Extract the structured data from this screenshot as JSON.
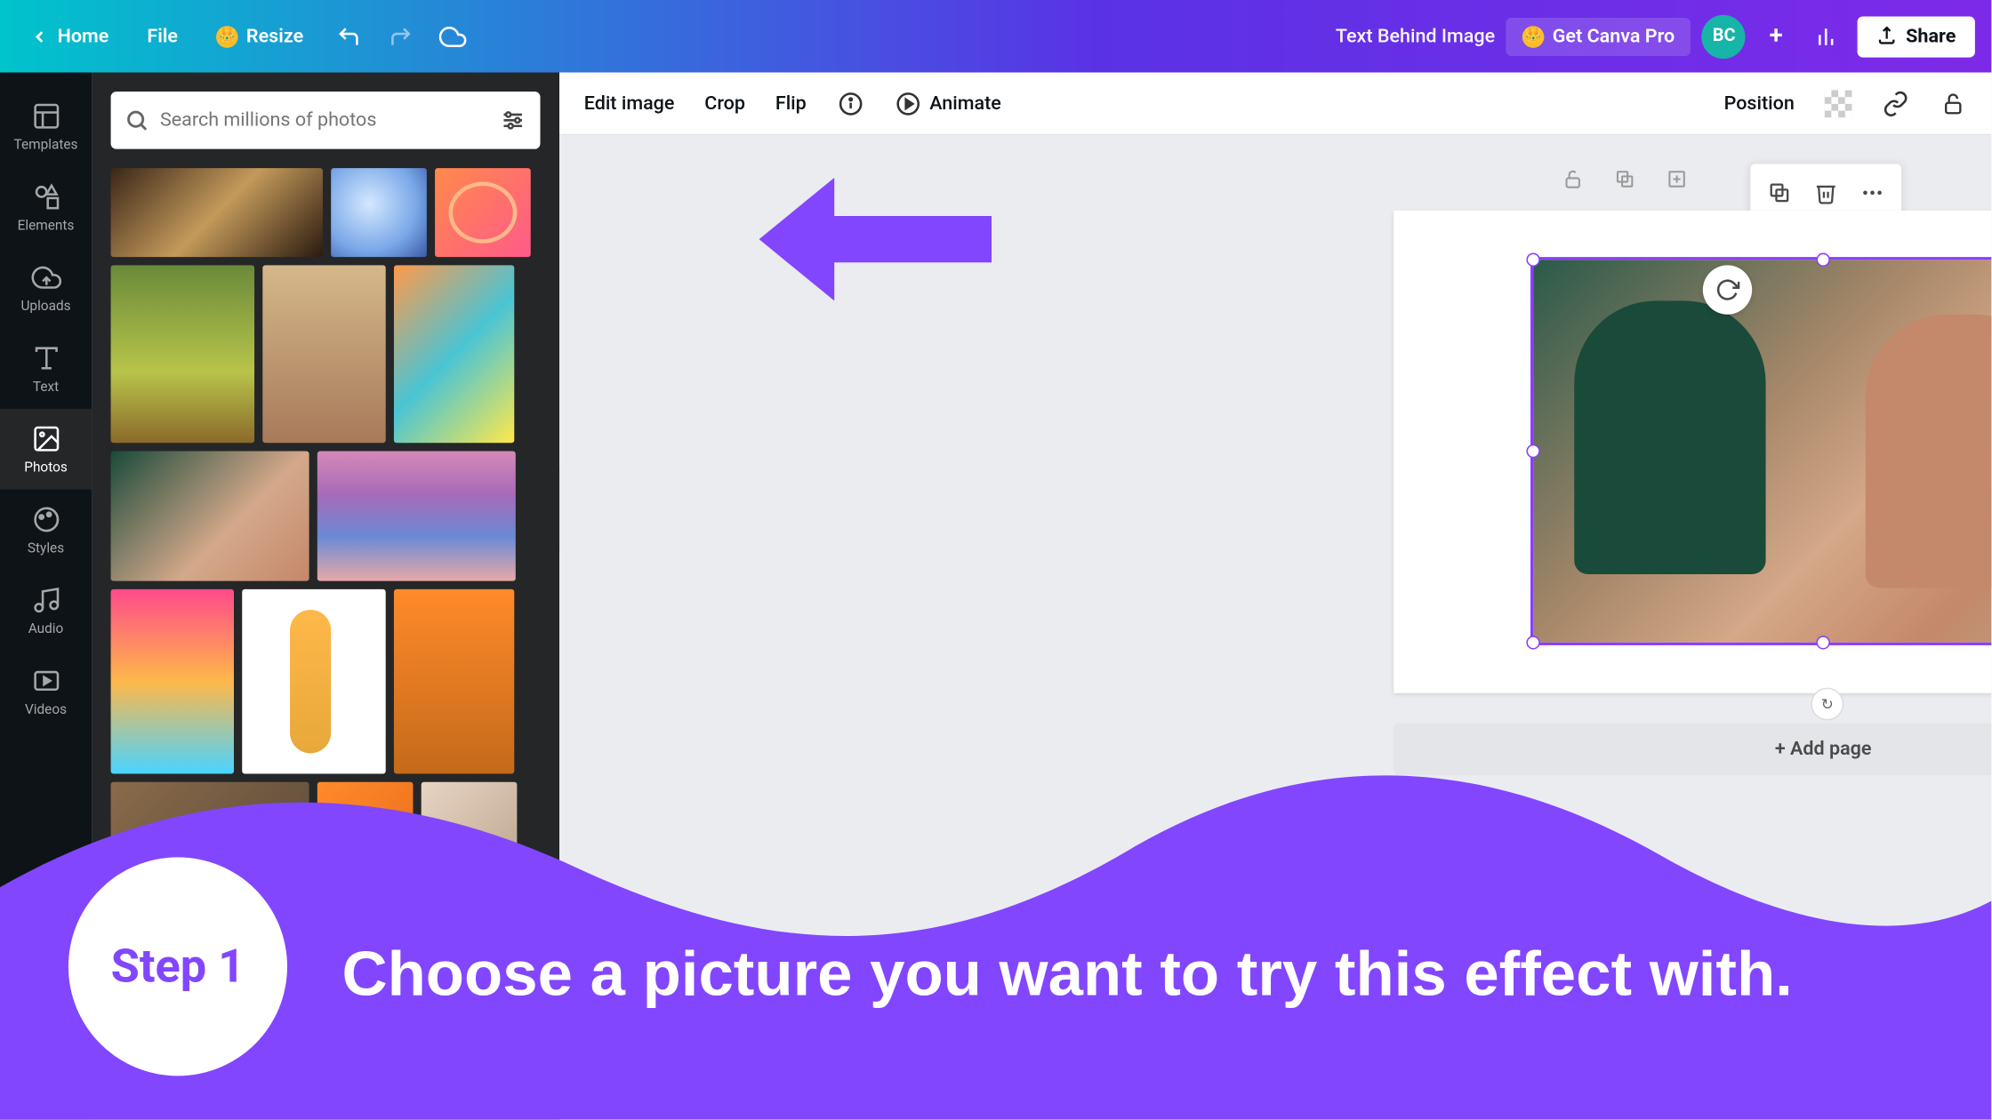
{
  "topbar": {
    "home": "Home",
    "file": "File",
    "resize": "Resize",
    "doc_title": "Text Behind Image",
    "get_pro": "Get Canva Pro",
    "avatar_initials": "BC",
    "share": "Share"
  },
  "sidebar": {
    "items": [
      {
        "label": "Templates"
      },
      {
        "label": "Elements"
      },
      {
        "label": "Uploads"
      },
      {
        "label": "Text"
      },
      {
        "label": "Photos"
      },
      {
        "label": "Styles"
      },
      {
        "label": "Audio"
      },
      {
        "label": "Videos"
      }
    ]
  },
  "search": {
    "placeholder": "Search millions of photos"
  },
  "ctx": {
    "edit_image": "Edit image",
    "crop": "Crop",
    "flip": "Flip",
    "animate": "Animate",
    "position": "Position"
  },
  "canvas": {
    "add_page": "+ Add page"
  },
  "overlay": {
    "step": "Step 1",
    "text": "Choose a picture you want to try this effect with."
  },
  "colors": {
    "purple": "#8246ff"
  }
}
